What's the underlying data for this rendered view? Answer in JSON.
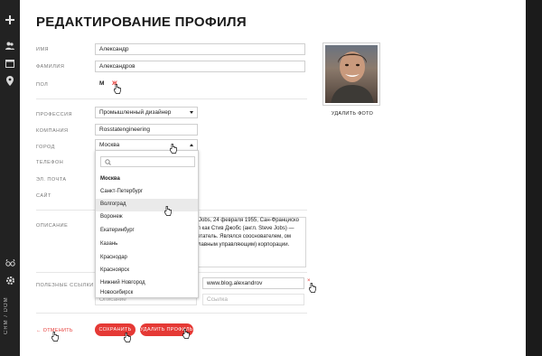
{
  "page": {
    "title": "РЕДАКТИРОВАНИЕ ПРОФИЛЯ"
  },
  "rail": {
    "logo_text": "CRM / DOM",
    "icons": [
      "plus-icon",
      "users-icon",
      "calendar-icon",
      "map-pin-icon",
      "glasses-icon",
      "gear-icon"
    ]
  },
  "form": {
    "name_label": "ИМЯ",
    "name_value": "Александр",
    "surname_label": "ФАМИЛИЯ",
    "surname_value": "Александров",
    "gender_label": "ПОЛ",
    "gender_m": "М",
    "gender_f": "Ж",
    "profession_label": "ПРОФЕССИЯ",
    "profession_value": "Промышленный дизайнер",
    "company_label": "КОМПАНИЯ",
    "company_value": "Rosstatengineering",
    "city_label": "ГОРОД",
    "city_value": "Москва",
    "phone_label": "ТЕЛЕФОН",
    "email_label": "ЭЛ. ПОЧТА",
    "site_label": "САЙТ",
    "description_label": "ОПИСАНИЕ",
    "description_text": "d Jobs, 24 февраля 1955, Сан-Франциско ал как Стив Джобс (англ. Steve Jobs) — ретатель. Являлся сооснователем, ом (главным управляющим) корпорации.",
    "links_label": "ПОЛЕЗНЫЕ ССЫЛКИ",
    "link_url_value": "www.blog.alexandrov",
    "link_desc_placeholder": "Описание",
    "link_url_placeholder": "Ссылка"
  },
  "photo": {
    "delete_label": "УДАЛИТЬ ФОТО"
  },
  "dropdown": {
    "items": [
      "Москва",
      "Санкт-Петербург",
      "Волгоград",
      "Воронеж",
      "Екатеринбург",
      "Казань",
      "Краснодар",
      "Красноярск",
      "Нижний Новгород",
      "Новосибирск"
    ]
  },
  "actions": {
    "cancel_label": "← ОТМЕНИТЬ",
    "save_label": "СОХРАНИТЬ",
    "delete_label": "УДАЛИТЬ ПРОФИЛЬ"
  },
  "colors": {
    "accent": "#e53935",
    "dark": "#1b1b1b"
  }
}
